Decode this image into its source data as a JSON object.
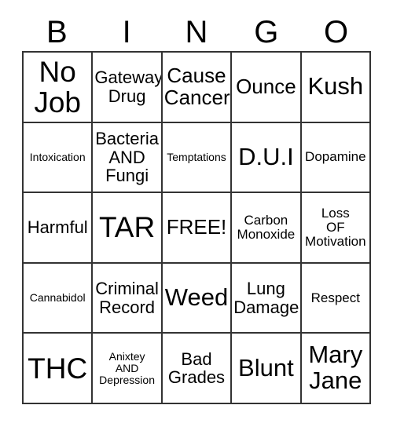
{
  "card": {
    "title": "BINGO",
    "header_letters": [
      "B",
      "I",
      "N",
      "G",
      "O"
    ],
    "free_space_label": "FREE!",
    "colors": {
      "background": "#ffffff",
      "text": "#000000",
      "grid_line": "#333333"
    },
    "grid": {
      "rows": 5,
      "columns": 5
    },
    "cells": [
      [
        {
          "text": "No\nJob",
          "size": "fs-xxl"
        },
        {
          "text": "Gateway\nDrug",
          "size": "fs-m"
        },
        {
          "text": "Cause\nCancer",
          "size": "fs-l"
        },
        {
          "text": "Ounce",
          "size": "fs-l"
        },
        {
          "text": "Kush",
          "size": "fs-xl"
        }
      ],
      [
        {
          "text": "Intoxication",
          "size": "fs-xs"
        },
        {
          "text": "Bacteria\nAND\nFungi",
          "size": "fs-m"
        },
        {
          "text": "Temptations",
          "size": "fs-xs"
        },
        {
          "text": "D.U.I",
          "size": "fs-xl"
        },
        {
          "text": "Dopamine",
          "size": "fs-s"
        }
      ],
      [
        {
          "text": "Harmful",
          "size": "fs-m"
        },
        {
          "text": "TAR",
          "size": "fs-xxl"
        },
        {
          "text": "FREE!",
          "size": "fs-l"
        },
        {
          "text": "Carbon\nMonoxide",
          "size": "fs-s"
        },
        {
          "text": "Loss\nOF\nMotivation",
          "size": "fs-s"
        }
      ],
      [
        {
          "text": "Cannabidol",
          "size": "fs-xs"
        },
        {
          "text": "Criminal\nRecord",
          "size": "fs-m"
        },
        {
          "text": "Weed",
          "size": "fs-xl"
        },
        {
          "text": "Lung\nDamage",
          "size": "fs-m"
        },
        {
          "text": "Respect",
          "size": "fs-s"
        }
      ],
      [
        {
          "text": "THC",
          "size": "fs-xxl"
        },
        {
          "text": "Anixtey\nAND\nDepression",
          "size": "fs-xs"
        },
        {
          "text": "Bad\nGrades",
          "size": "fs-m"
        },
        {
          "text": "Blunt",
          "size": "fs-xl"
        },
        {
          "text": "Mary\nJane",
          "size": "fs-xl"
        }
      ]
    ]
  }
}
